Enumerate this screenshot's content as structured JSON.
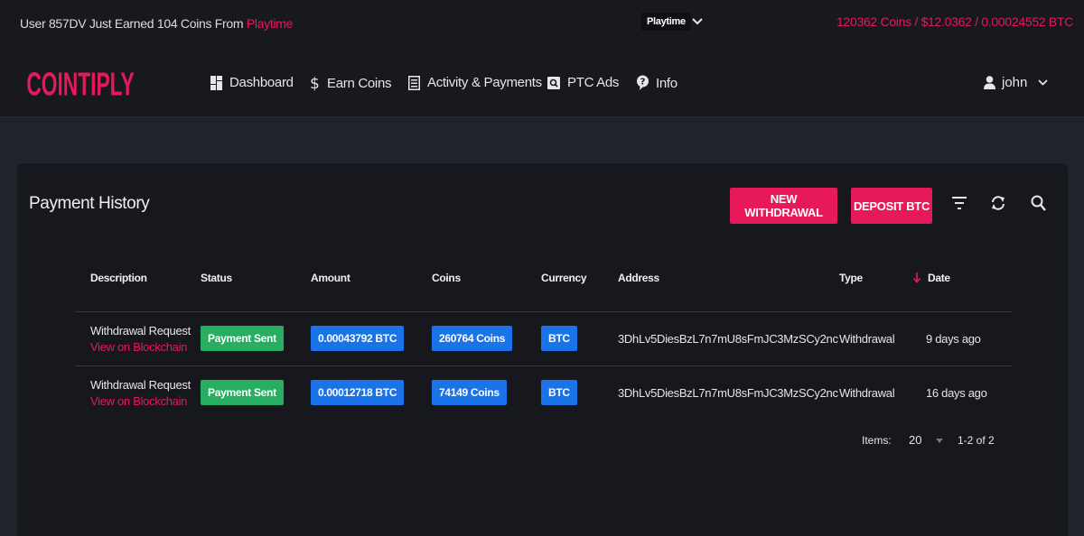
{
  "ticker": {
    "prefix": "User 857DV Just Earned 104 Coins From ",
    "source": "Playtime",
    "selector": "Playtime",
    "balance": "120362 Coins / $12.0362 / 0.00024552 BTC"
  },
  "nav": {
    "logo": "COINTIPLY",
    "items": [
      {
        "label": "Dashboard",
        "icon": "dashboard-icon"
      },
      {
        "label": "Earn Coins",
        "icon": "dollar-icon"
      },
      {
        "label": "Activity & Payments",
        "icon": "list-icon"
      },
      {
        "label": "PTC Ads",
        "icon": "ptc-icon"
      },
      {
        "label": "Info",
        "icon": "info-icon"
      }
    ],
    "user": "john"
  },
  "card": {
    "title": "Payment History",
    "new_withdrawal": "NEW WITHDRAWAL",
    "deposit": "DEPOSIT BTC"
  },
  "table": {
    "headers": [
      "Description",
      "Status",
      "Amount",
      "Coins",
      "Currency",
      "Address",
      "Type",
      "Date"
    ],
    "rows": [
      {
        "description": "Withdrawal Request",
        "link": "View on Blockchain",
        "status": "Payment Sent",
        "amount": "0.00043792 BTC",
        "coins": "260764 Coins",
        "currency": "BTC",
        "address": "3DhLv5DiesBzL7n7mU8sFmJC3MzSCy2nc",
        "type": "Withdrawal",
        "date": "9 days ago"
      },
      {
        "description": "Withdrawal Request",
        "link": "View on Blockchain",
        "status": "Payment Sent",
        "amount": "0.00012718 BTC",
        "coins": "74149 Coins",
        "currency": "BTC",
        "address": "3DhLv5DiesBzL7n7mU8sFmJC3MzSCy2nc",
        "type": "Withdrawal",
        "date": "16 days ago"
      }
    ]
  },
  "pagination": {
    "items_label": "Items:",
    "per_page": "20",
    "range": "1-2 of 2"
  },
  "colors": {
    "accent": "#e8195a",
    "green": "#27ae60",
    "blue": "#1a73e8"
  }
}
